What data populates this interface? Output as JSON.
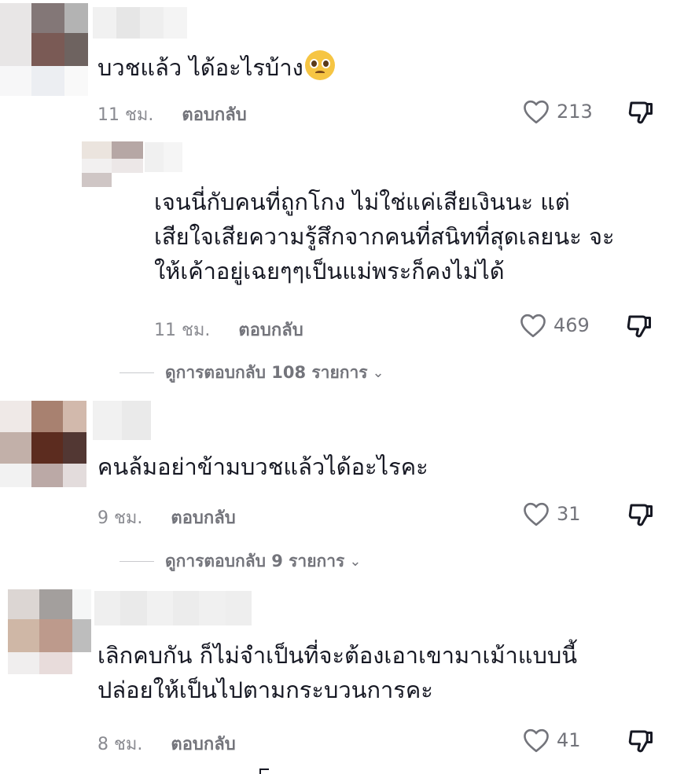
{
  "comments": [
    {
      "text_lines": [
        "บวชแล้ว ได้อะไรบ้าง"
      ],
      "emoji": "pleading-face",
      "time": "11 ชม.",
      "reply_label": "ตอบกลับ",
      "likes": "213",
      "avatar_colors": [
        "#e8e6e6",
        "#837777",
        "#b3b3b3",
        "#e8e6e6",
        "#7a5a55",
        "#6e6360",
        "#f7f7f8",
        "#eceef2",
        "#f9f9f9"
      ],
      "name_colors": [
        "#f1f1f1",
        "#e6e6e6",
        "#eeeeee",
        "#f4f4f4"
      ]
    },
    {
      "text_lines": [
        "เจนนี่กับคนที่ถูกโกง ไม่ใช่แค่เสียเงินนะ แต่",
        "เสียใจเสียความรู้สึกจากคนที่สนิทที่สุดเลยนะ จะ",
        "ให้เค้าอยู่เฉยๆๆเป็นแม่พระก็คงไม่ได้"
      ],
      "time": "11 ชม.",
      "reply_label": "ตอบกลับ",
      "likes": "469",
      "avatar_colors": [
        "#ebe4de",
        "#b6a7a5",
        "#f2f0f0",
        "#ece7e7",
        "#cfc6c5",
        "#ffffff"
      ],
      "name_colors": [
        "#f0f0f0",
        "#f5f5f5"
      ]
    },
    {
      "view_replies": "ดูการตอบกลับ 108 รายการ"
    },
    {
      "text_lines": [
        "คนล้มอย่าข้ามบวชแล้วได้อะไรคะ"
      ],
      "time": "9 ชม.",
      "reply_label": "ตอบกลับ",
      "likes": "31",
      "avatar_colors": [
        "#efe9e7",
        "#a88170",
        "#d2b9ac",
        "#c2b0a9",
        "#5c2c1f",
        "#523733",
        "#f2f2f2",
        "#bba9a6",
        "#e3dcdc"
      ],
      "name_colors": [
        "#f1f1f1",
        "#eaeaea"
      ]
    },
    {
      "view_replies": "ดูการตอบกลับ 9 รายการ"
    },
    {
      "text_lines": [
        "เลิกคบกัน ก็ไม่จำเป็นที่จะต้องเอาเขามาเม้าแบบนี้",
        "ปล่อยให้เป็นไปตามกระบวนการคะ"
      ],
      "time": "8 ชม.",
      "reply_label": "ตอบกลับ",
      "likes": "41",
      "avatar_colors": [
        "#dcd6d3",
        "#a39f9d",
        "#f5f6f6",
        "#cfb7a6",
        "#bd9a8c",
        "#bdbdbd",
        "#f0eeee",
        "#e8dcdb",
        "#ffffff"
      ],
      "name_colors": [
        "#efefef",
        "#eaeaea",
        "#f1f1f1",
        "#ececec",
        "#f0f0f0",
        "#eeeeee"
      ]
    }
  ],
  "icons": {
    "like": "heart-outline-icon",
    "dislike": "thumbs-down-icon",
    "chevron": "chevron-down-icon"
  }
}
